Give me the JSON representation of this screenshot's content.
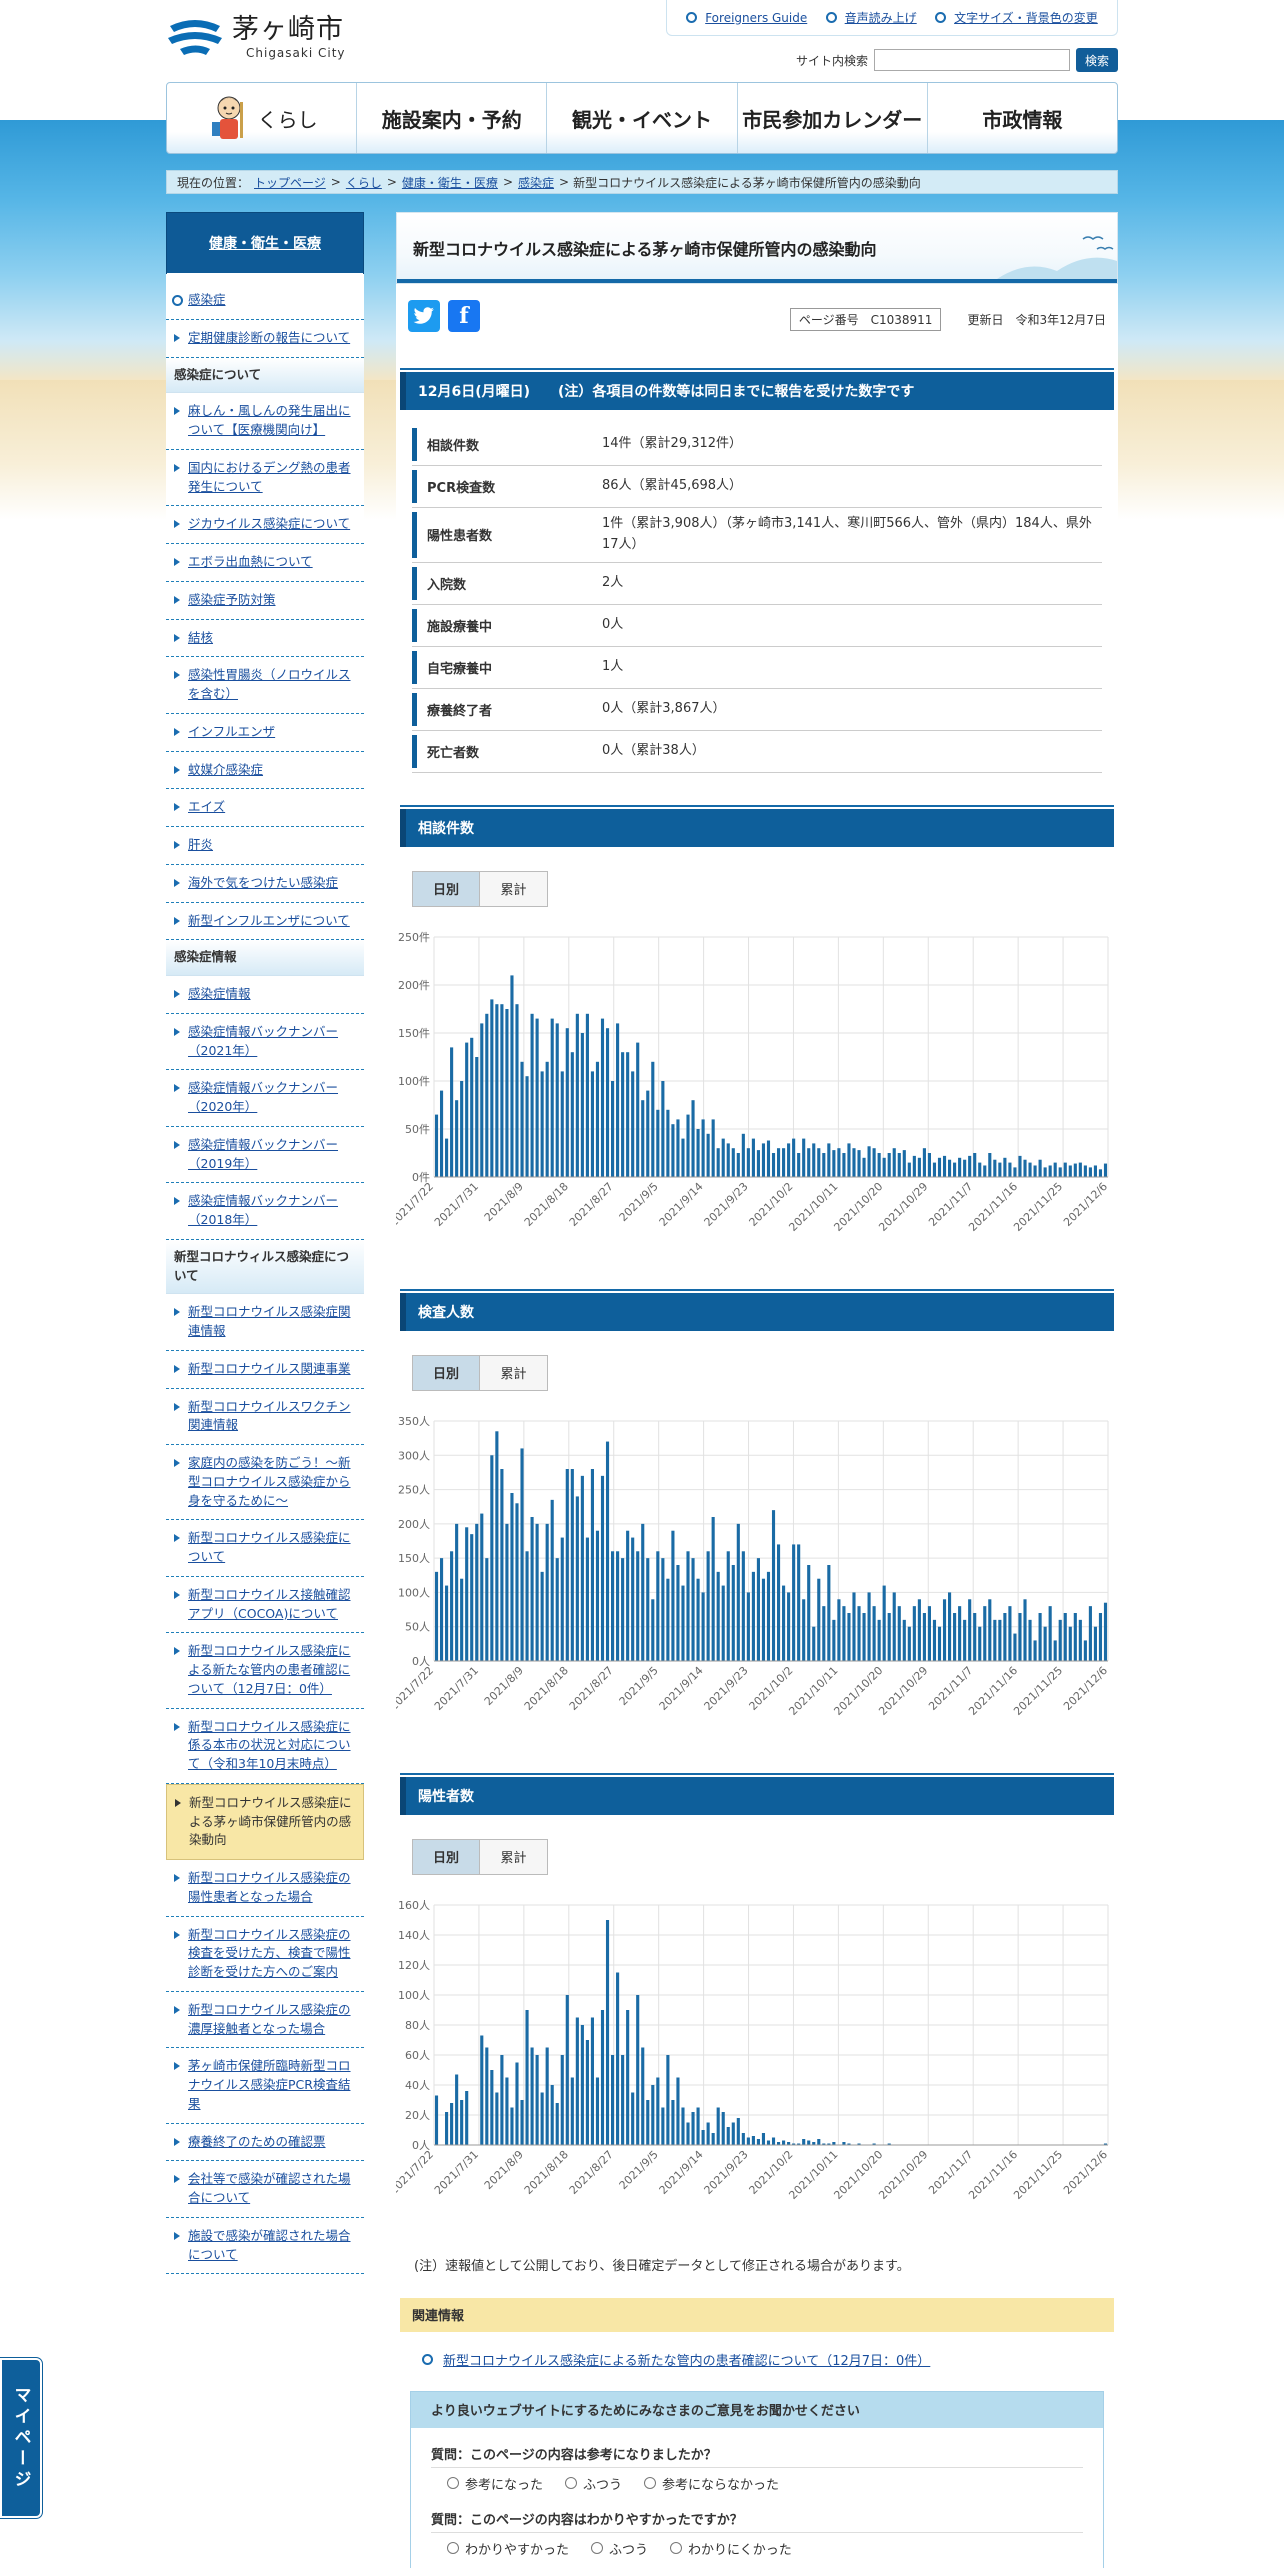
{
  "header": {
    "logo_jp": "茅ヶ崎市",
    "logo_en": "Chigasaki City",
    "util_links": [
      "Foreigners Guide",
      "音声読み上げ",
      "文字サイズ・背景色の変更"
    ],
    "search_label": "サイト内検索",
    "search_button": "検索"
  },
  "gnav": [
    "くらし",
    "施設案内・予約",
    "観光・イベント",
    "市民参加カレンダー",
    "市政情報"
  ],
  "breadcrumb": {
    "prefix": "現在の位置：",
    "links": [
      "トップページ",
      "くらし",
      "健康・衛生・医療",
      "感染症"
    ],
    "current": "新型コロナウイルス感染症による茅ヶ崎市保健所管内の感染動向"
  },
  "sidebar": {
    "head": "健康・衛生・医療",
    "groups": [
      {
        "cat": "",
        "items": [
          "感染症",
          "定期健康診断の報告について"
        ]
      },
      {
        "cat": "感染症について",
        "items": [
          "麻しん・風しんの発生届出について【医療機関向け】",
          "国内におけるデング熱の患者発生について",
          "ジカウイルス感染症について",
          "エボラ出血熱について",
          "感染症予防対策",
          "結核",
          "感染性胃腸炎（ノロウイルスを含む）",
          "インフルエンザ",
          "蚊媒介感染症",
          "エイズ",
          "肝炎",
          "海外で気をつけたい感染症",
          "新型インフルエンザについて"
        ]
      },
      {
        "cat": "感染症情報",
        "items": [
          "感染症情報",
          "感染症情報バックナンバー（2021年）",
          "感染症情報バックナンバー（2020年）",
          "感染症情報バックナンバー（2019年）",
          "感染症情報バックナンバー（2018年）"
        ]
      },
      {
        "cat": "新型コロナウィルス感染症について",
        "items": [
          "新型コロナウイルス感染症関連情報",
          "新型コロナウイルス関連事業",
          "新型コロナウイルスワクチン関連情報",
          "家庭内の感染を防ごう！～新型コロナウイルス感染症から身を守るために～",
          "新型コロナウイルス感染症について",
          "新型コロナウイルス接触確認アプリ（COCOA)について",
          "新型コロナウイルス感染症による新たな管内の患者確認について（12月7日：0件）",
          "新型コロナウイルス感染症に係る本市の状況と対応について（令和3年10月末時点）",
          "新型コロナウイルス感染症による茅ヶ崎市保健所管内の感染動向",
          "新型コロナウイルス感染症の陽性患者となった場合",
          "新型コロナウイルス感染症の検査を受けた方、検査で陽性診断を受けた方へのご案内",
          "新型コロナウイルス感染症の濃厚接触者となった場合",
          "茅ヶ崎市保健所臨時新型コロナウイルス感染症PCR検査結果",
          "療養終了のための確認票",
          "会社等で感染が確認された場合について",
          "施設で感染が確認された場合について"
        ]
      }
    ],
    "current_item": "新型コロナウイルス感染症による茅ヶ崎市保健所管内の感染動向"
  },
  "main": {
    "title": "新型コロナウイルス感染症による茅ヶ崎市保健所管内の感染動向",
    "page_number": "ページ番号　C1038911",
    "updated": "更新日　令和3年12月7日",
    "summary_head": "12月6日(月曜日)　　(注）各項目の件数等は同日までに報告を受けた数字です",
    "summary_rows": [
      {
        "k": "相談件数",
        "v": "14件（累計29,312件）"
      },
      {
        "k": "PCR検査数",
        "v": "86人（累計45,698人）"
      },
      {
        "k": "陽性患者数",
        "v": "1件（累計3,908人）（茅ヶ崎市3,141人、寒川町566人、管外（県内）184人、県外17人）"
      },
      {
        "k": "入院数",
        "v": "2人"
      },
      {
        "k": "施設療養中",
        "v": "0人"
      },
      {
        "k": "自宅療養中",
        "v": "1人"
      },
      {
        "k": "療養終了者",
        "v": "0人（累計3,867人）"
      },
      {
        "k": "死亡者数",
        "v": "0人（累計38人）"
      }
    ],
    "tab_daily": "日別",
    "tab_cumulative": "累計",
    "note": "(注）速報値として公開しており、後日確定データとして修正される場合があります。",
    "related_head": "関連情報",
    "related_link": "新型コロナウイルス感染症による新たな管内の患者確認について（12月7日：0件）",
    "survey": {
      "head": "より良いウェブサイトにするためにみなさまのご意見をお聞かせください",
      "q1": "質問：このページの内容は参考になりましたか？",
      "q1_opts": [
        "参考になった",
        "ふつう",
        "参考にならなかった"
      ],
      "q2": "質問：このページの内容はわかりやすかったですか？",
      "q2_opts": [
        "わかりやすかった",
        "ふつう",
        "わかりにくかった"
      ]
    }
  },
  "mypage": "マイページ",
  "colors": {
    "primary": "#0e5f9b",
    "bar": "#1a6ba5",
    "current": "#f8e7a6"
  },
  "chart_data": [
    {
      "type": "bar",
      "title": "相談件数",
      "unit": "件",
      "x_tick_labels": [
        "2021/7/22",
        "2021/7/31",
        "2021/8/9",
        "2021/8/18",
        "2021/8/27",
        "2021/9/5",
        "2021/9/14",
        "2021/9/23",
        "2021/10/2",
        "2021/10/11",
        "2021/10/20",
        "2021/10/29",
        "2021/11/7",
        "2021/11/16",
        "2021/11/25",
        "2021/12/6"
      ],
      "y_ticks": [
        "0件",
        "50件",
        "100件",
        "150件",
        "200件",
        "250件"
      ],
      "ylim": [
        0,
        250
      ],
      "grid": true,
      "values": [
        65,
        90,
        40,
        135,
        80,
        100,
        140,
        145,
        125,
        160,
        170,
        185,
        180,
        180,
        175,
        210,
        180,
        120,
        105,
        170,
        165,
        110,
        120,
        165,
        160,
        110,
        155,
        130,
        170,
        150,
        170,
        110,
        120,
        165,
        155,
        100,
        160,
        130,
        130,
        110,
        140,
        80,
        90,
        120,
        70,
        100,
        70,
        55,
        60,
        40,
        65,
        80,
        50,
        60,
        45,
        60,
        30,
        40,
        35,
        30,
        25,
        45,
        30,
        40,
        28,
        35,
        38,
        25,
        30,
        30,
        35,
        40,
        25,
        40,
        30,
        35,
        30,
        25,
        35,
        28,
        30,
        25,
        35,
        30,
        28,
        20,
        32,
        30,
        25,
        20,
        25,
        30,
        25,
        28,
        15,
        22,
        20,
        30,
        25,
        15,
        20,
        22,
        18,
        15,
        20,
        18,
        22,
        25,
        15,
        12,
        25,
        18,
        15,
        20,
        15,
        10,
        22,
        18,
        15,
        12,
        18,
        10,
        12,
        15,
        10,
        15,
        12,
        14,
        15,
        12,
        10,
        12,
        8,
        14
      ]
    },
    {
      "type": "bar",
      "title": "検査人数",
      "unit": "人",
      "x_tick_labels": [
        "2021/7/22",
        "2021/7/31",
        "2021/8/9",
        "2021/8/18",
        "2021/8/27",
        "2021/9/5",
        "2021/9/14",
        "2021/9/23",
        "2021/10/2",
        "2021/10/11",
        "2021/10/20",
        "2021/10/29",
        "2021/11/7",
        "2021/11/16",
        "2021/11/25",
        "2021/12/6"
      ],
      "y_ticks": [
        "0人",
        "50人",
        "100人",
        "150人",
        "200人",
        "250人",
        "300人",
        "350人"
      ],
      "ylim": [
        0,
        350
      ],
      "grid": true,
      "values": [
        130,
        150,
        110,
        160,
        200,
        120,
        195,
        185,
        200,
        215,
        150,
        300,
        335,
        280,
        200,
        245,
        230,
        310,
        160,
        210,
        200,
        130,
        200,
        235,
        150,
        180,
        280,
        280,
        240,
        270,
        180,
        280,
        190,
        270,
        320,
        160,
        160,
        150,
        190,
        180,
        160,
        200,
        150,
        90,
        160,
        150,
        120,
        190,
        140,
        110,
        160,
        150,
        120,
        100,
        160,
        210,
        130,
        110,
        160,
        140,
        200,
        160,
        100,
        130,
        150,
        120,
        130,
        220,
        170,
        110,
        100,
        170,
        170,
        90,
        140,
        50,
        120,
        80,
        140,
        60,
        90,
        80,
        70,
        100,
        80,
        70,
        100,
        80,
        60,
        110,
        70,
        100,
        80,
        60,
        50,
        80,
        90,
        70,
        80,
        60,
        50,
        90,
        100,
        70,
        80,
        60,
        90,
        70,
        50,
        80,
        90,
        60,
        60,
        70,
        80,
        40,
        70,
        90,
        60,
        30,
        70,
        50,
        80,
        30,
        60,
        70,
        50,
        70,
        60,
        30,
        80,
        50,
        70,
        85
      ]
    },
    {
      "type": "bar",
      "title": "陽性者数",
      "unit": "人",
      "x_tick_labels": [
        "2021/7/22",
        "2021/7/31",
        "2021/8/9",
        "2021/8/18",
        "2021/8/27",
        "2021/9/5",
        "2021/9/14",
        "2021/9/23",
        "2021/10/2",
        "2021/10/11",
        "2021/10/20",
        "2021/10/29",
        "2021/11/7",
        "2021/11/16",
        "2021/11/25",
        "2021/12/6"
      ],
      "y_ticks": [
        "0人",
        "20人",
        "40人",
        "60人",
        "80人",
        "100人",
        "120人",
        "140人",
        "160人"
      ],
      "ylim": [
        0,
        160
      ],
      "grid": true,
      "values": [
        33,
        0,
        22,
        28,
        47,
        30,
        36,
        0,
        0,
        73,
        65,
        50,
        35,
        60,
        45,
        25,
        55,
        30,
        90,
        65,
        60,
        35,
        65,
        40,
        28,
        60,
        100,
        45,
        85,
        80,
        70,
        85,
        45,
        90,
        150,
        60,
        115,
        60,
        90,
        35,
        100,
        65,
        30,
        40,
        45,
        25,
        60,
        30,
        45,
        25,
        15,
        22,
        25,
        10,
        15,
        8,
        25,
        22,
        12,
        15,
        18,
        8,
        5,
        6,
        4,
        8,
        3,
        5,
        2,
        3,
        2,
        1,
        1,
        4,
        3,
        2,
        4,
        1,
        1,
        2,
        0,
        2,
        1,
        0,
        1,
        0,
        0,
        1,
        0,
        0,
        1,
        0,
        0,
        0,
        0,
        0,
        0,
        0,
        0,
        0,
        0,
        0,
        0,
        0,
        0,
        0,
        0,
        0,
        0,
        0,
        0,
        0,
        0,
        0,
        0,
        0,
        0,
        0,
        0,
        0,
        0,
        0,
        0,
        0,
        0,
        0,
        0,
        0,
        0,
        0,
        0,
        0,
        0,
        1
      ]
    }
  ]
}
